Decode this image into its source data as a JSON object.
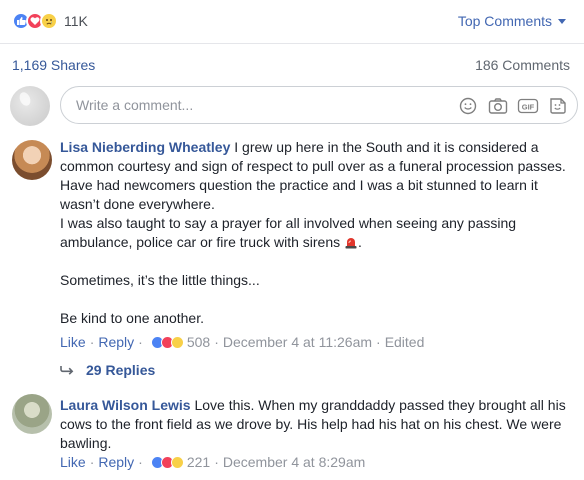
{
  "header": {
    "reaction_count": "11K",
    "sort_label": "Top Comments"
  },
  "stats": {
    "shares": "1,169 Shares",
    "comments": "186 Comments"
  },
  "composer": {
    "placeholder": "Write a comment...",
    "gif_label": "GIF"
  },
  "comments": [
    {
      "author": "Lisa Nieberding Wheatley",
      "lines": [
        "I grew up here in the South and it is considered a common courtesy and sign of respect to pull over as a funeral procession passes.",
        "Have had newcomers question the practice and I was a bit stunned to learn it wasn’t done everywhere.",
        "I was also taught to say a prayer for all involved when seeing any passing ambulance, police car or fire truck with sirens",
        "Sometimes, it’s the little things...",
        "Be kind to one another."
      ],
      "siren_icon": "rotating-light-icon",
      "like": "Like",
      "reply": "Reply",
      "reaction_count": "508",
      "timestamp": "December 4 at 11:26am",
      "edited": "Edited",
      "replies_label": "29 Replies"
    },
    {
      "author": "Laura Wilson Lewis",
      "text": "Love this. When my granddaddy passed they brought all his cows to the front field as we drove by. His help had his hat on his chest. We were bawling.",
      "like": "Like",
      "reply": "Reply",
      "reaction_count": "221",
      "timestamp": "December 4 at 8:29am"
    }
  ],
  "colors": {
    "link": "#365899",
    "action_link": "#4267b2",
    "meta": "#90949c",
    "like_blue": "#4c83f4",
    "love_red": "#f2415a",
    "sad_yellow": "#f8d048"
  }
}
